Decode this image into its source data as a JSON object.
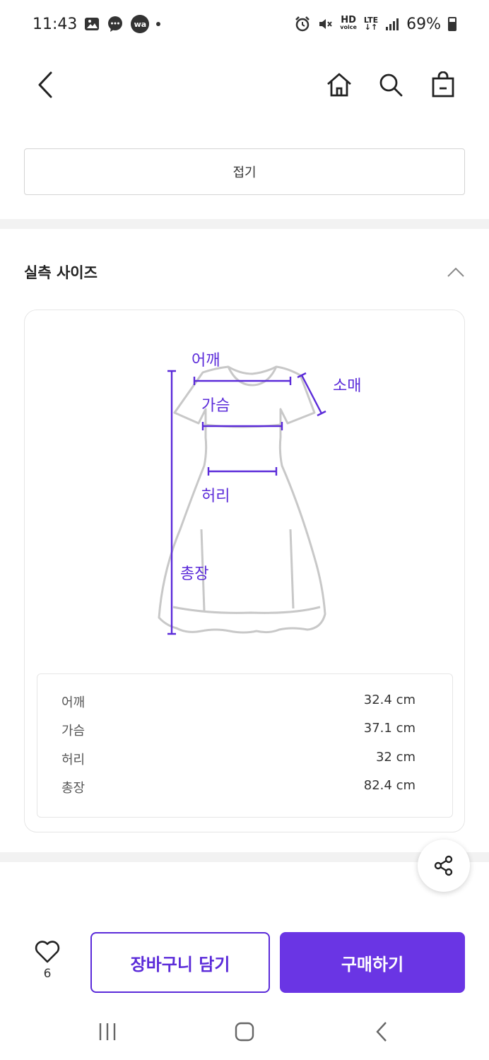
{
  "status_bar": {
    "time": "11:43",
    "wa_badge": "wa",
    "hd_label": "HD",
    "voice_label": "voice",
    "lte_label": "LTE",
    "battery": "69%",
    "icons": [
      "gallery-icon",
      "chat-icon",
      "wa-icon",
      "dot-icon",
      "alarm-icon",
      "mute-icon",
      "signal-icon",
      "battery-icon"
    ]
  },
  "header": {
    "icons": [
      "back-arrow-icon",
      "home-icon",
      "search-icon",
      "shopping-bag-icon"
    ]
  },
  "collapse": {
    "label": "접기"
  },
  "size_section": {
    "title": "실측 사이즈",
    "toggle_icon": "chevron-up-icon",
    "diagram": {
      "labels": {
        "shoulder": "어깨",
        "chest": "가슴",
        "sleeve": "소매",
        "waist": "허리",
        "length": "총장"
      },
      "accent_color": "#5b2bd9",
      "outline_color": "#c8c8c8"
    },
    "rows": [
      {
        "label": "어깨",
        "value": "32.4 cm"
      },
      {
        "label": "가슴",
        "value": "37.1 cm"
      },
      {
        "label": "허리",
        "value": "32 cm"
      },
      {
        "label": "총장",
        "value": "82.4 cm"
      }
    ]
  },
  "share": {
    "icon": "share-icon"
  },
  "actions": {
    "like_icon": "heart-icon",
    "like_count": "6",
    "cart_label": "장바구니 담기",
    "buy_label": "구매하기",
    "primary_color": "#6a35e4"
  },
  "nav": {
    "icons": [
      "recent-apps-icon",
      "home-nav-icon",
      "back-nav-icon"
    ]
  }
}
